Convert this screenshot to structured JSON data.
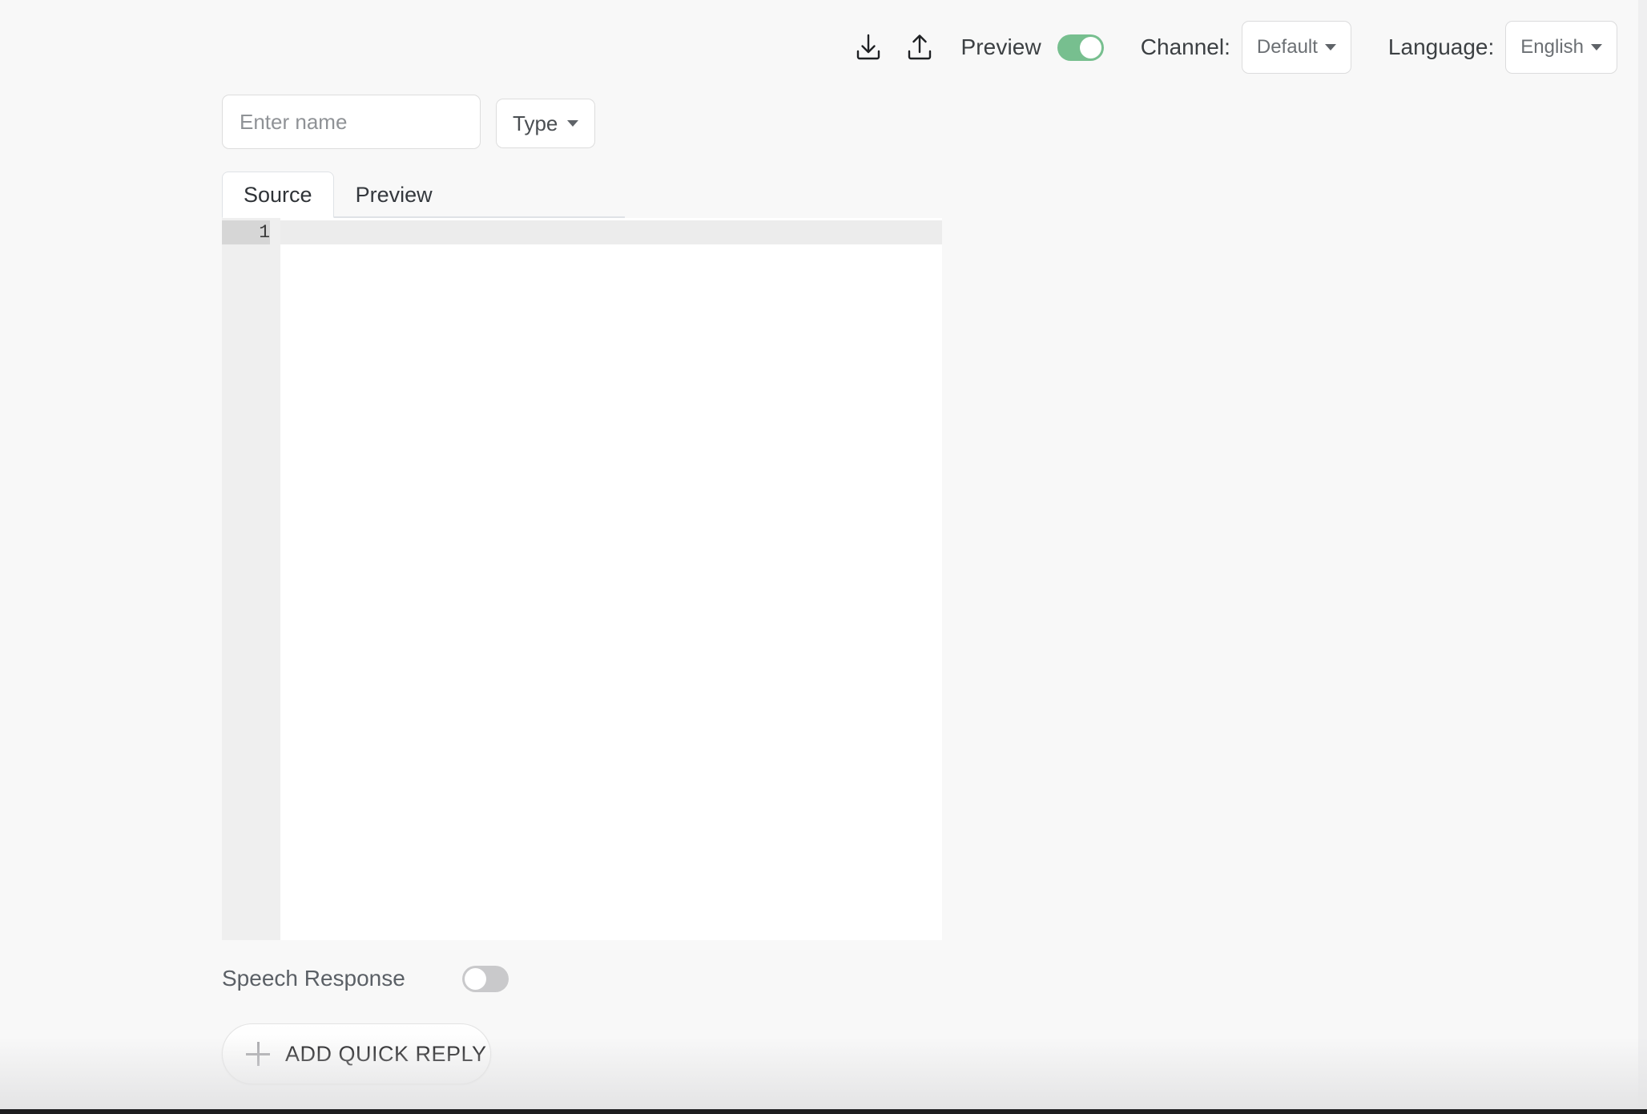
{
  "topbar": {
    "download_icon": "download-icon",
    "upload_icon": "upload-icon",
    "preview_label": "Preview",
    "preview_toggle_state": "on",
    "channel_label": "Channel:",
    "channel_value": "Default",
    "language_label": "Language:",
    "language_value": "English"
  },
  "form": {
    "name_placeholder": "Enter name",
    "name_value": "",
    "type_label": "Type"
  },
  "tabs": {
    "items": [
      {
        "label": "Source",
        "active": true
      },
      {
        "label": "Preview",
        "active": false
      }
    ]
  },
  "editor": {
    "lines": [
      {
        "number": "1",
        "text": "",
        "active": true
      }
    ]
  },
  "speech": {
    "label": "Speech Response",
    "toggle_state": "off"
  },
  "quick_reply": {
    "label": "ADD QUICK REPLY",
    "icon": "plus-icon"
  },
  "colors": {
    "page_background": "#f8f8f8",
    "toggle_on": "#77bf8f",
    "toggle_off": "#c9c9cb",
    "editor_background": "#ffffff",
    "gutter_background": "#efefef",
    "active_line": "#ececec",
    "border": "#dddddd"
  }
}
